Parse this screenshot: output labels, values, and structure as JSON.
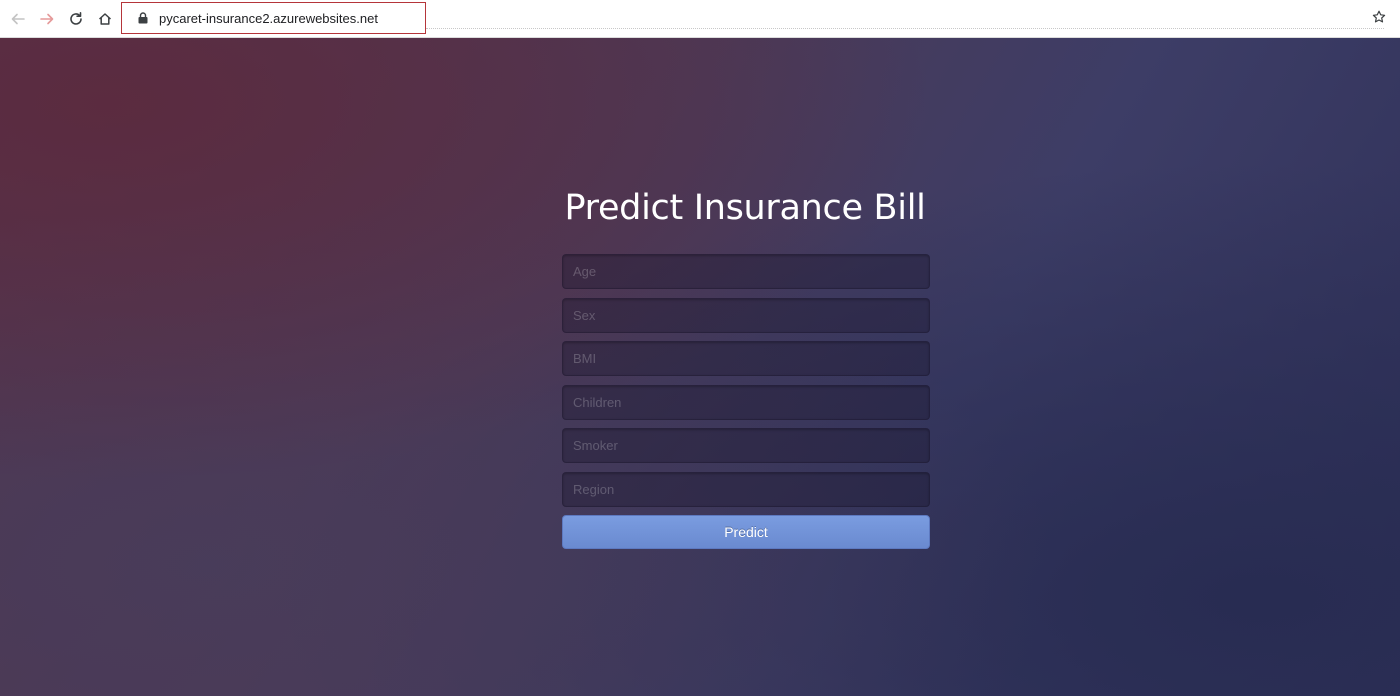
{
  "browser": {
    "url": "pycaret-insurance2.azurewebsites.net",
    "icons": [
      "back-arrow-icon",
      "forward-arrow-icon",
      "reload-icon",
      "home-icon",
      "lock-icon",
      "star-icon"
    ]
  },
  "page": {
    "title": "Predict Insurance Bill",
    "fields": {
      "age_placeholder": "Age",
      "sex_placeholder": "Sex",
      "bmi_placeholder": "BMI",
      "children_placeholder": "Children",
      "smoker_placeholder": "Smoker",
      "region_placeholder": "Region"
    },
    "submit_label": "Predict"
  },
  "colors": {
    "button": "#6f91d8",
    "background_dark": "#2e3058",
    "background_warm": "#55344c"
  }
}
